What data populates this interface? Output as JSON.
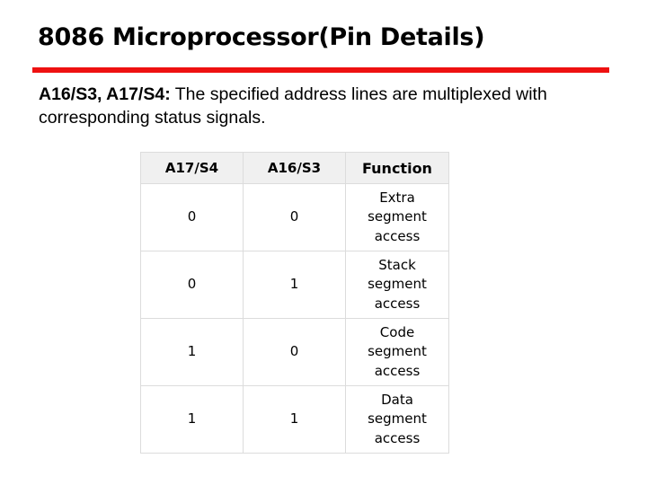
{
  "slide": {
    "title": "8086 Microprocessor(Pin Details)",
    "accent_color": "#ee1111",
    "description": {
      "bold_prefix": "A16/S3, A17/S4:",
      "text": " The specified address lines are multiplexed with corresponding status signals."
    }
  },
  "table": {
    "headers": [
      "A17/S4",
      "A16/S3",
      "Function"
    ],
    "rows": [
      {
        "a17_s4": "0",
        "a16_s3": "0",
        "function": "Extra segment access"
      },
      {
        "a17_s4": "0",
        "a16_s3": "1",
        "function": "Stack segment access"
      },
      {
        "a17_s4": "1",
        "a16_s3": "0",
        "function": "Code segment access"
      },
      {
        "a17_s4": "1",
        "a16_s3": "1",
        "function": "Data segment access"
      }
    ]
  }
}
